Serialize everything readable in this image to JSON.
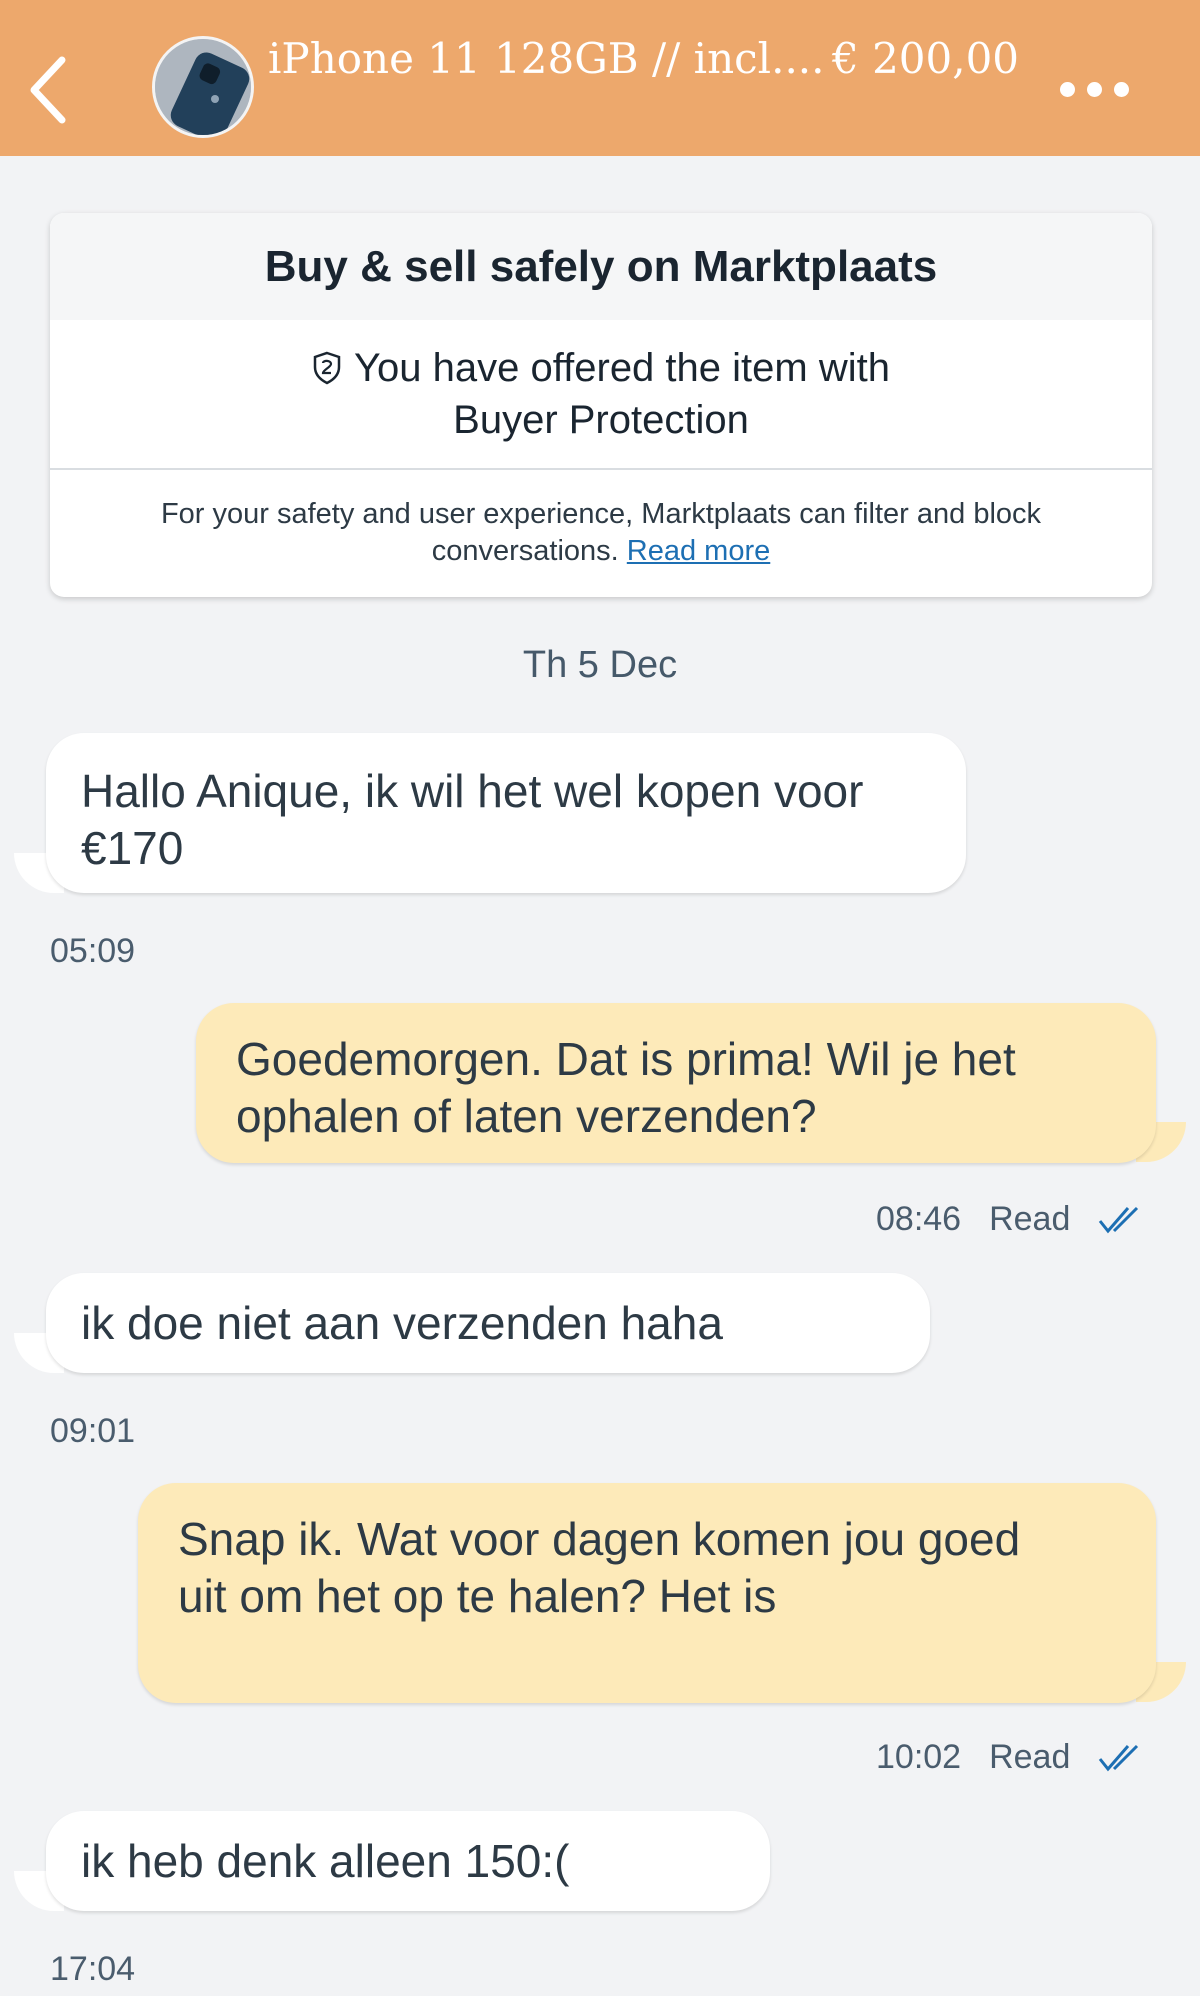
{
  "header": {
    "title": "iPhone 11 128GB // incl....",
    "price": "€ 200,00",
    "bg_color": "#eda86c"
  },
  "safety_card": {
    "heading": "Buy & sell safely on Marktplaats",
    "protection_line1": "You have offered the item with",
    "protection_line2": "Buyer Protection",
    "notice_line1": "For your safety and user experience, Marktplaats can filter and block",
    "notice_line2": "conversations.",
    "read_more": "Read more"
  },
  "date_separator": "Th 5 Dec",
  "messages": [
    {
      "direction": "in",
      "lines": [
        "Hallo Anique, ik wil het wel kopen voor",
        "€170"
      ],
      "time": "05:09"
    },
    {
      "direction": "out",
      "lines": [
        "Goedemorgen. Dat is prima! Wil je het",
        "ophalen of laten verzenden?"
      ],
      "time": "08:46",
      "status": "Read"
    },
    {
      "direction": "in",
      "lines": [
        "ik doe niet aan verzenden haha"
      ],
      "time": "09:01"
    },
    {
      "direction": "out",
      "lines": [
        "Snap ik. Wat voor dagen komen jou goed",
        "uit om het op te halen? Het is"
      ],
      "time": "10:02",
      "status": "Read"
    },
    {
      "direction": "in",
      "lines": [
        "ik heb denk alleen 150:("
      ],
      "time": "17:04"
    }
  ],
  "colors": {
    "incoming_bubble": "#ffffff",
    "outgoing_bubble": "#fdeab9",
    "read_check": "#1d6fb3"
  }
}
